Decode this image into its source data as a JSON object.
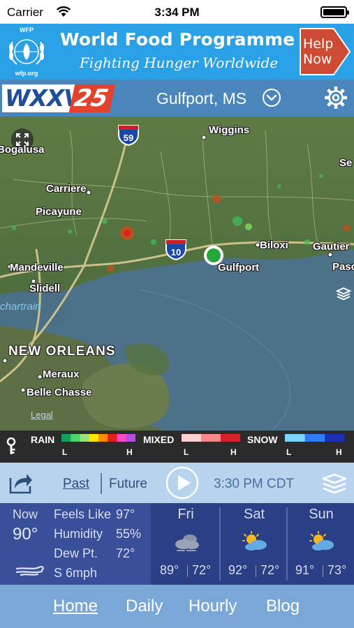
{
  "status_bar": {
    "carrier": "Carrier",
    "time": "3:34 PM"
  },
  "ad": {
    "logo_top": "WFP",
    "logo_bottom": "wfp.org",
    "title": "World Food Programme",
    "subtitle": "Fighting Hunger Worldwide",
    "cta": "Help Now"
  },
  "header": {
    "logo_letters": "WXXV",
    "logo_number": "25",
    "location": "Gulfport, MS"
  },
  "map": {
    "labels": {
      "bogalusa": "Bogalusa",
      "wiggins": "Wiggins",
      "carriere": "Carriere",
      "picayune": "Picayune",
      "biloxi": "Biloxi",
      "gautier": "Gautier",
      "mandeville": "Mandeville",
      "gulfport": "Gulfport",
      "pasc": "Pasc",
      "slidell": "Slidell",
      "lake": "tchartrain",
      "se": "Se",
      "new_orleans": "New Orleans",
      "meraux": "Meraux",
      "belle_chasse": "Belle Chasse",
      "legal": "Legal"
    },
    "shields": {
      "i59": "59",
      "i10": "10"
    }
  },
  "legend": {
    "rain": "RAIN",
    "mixed": "MIXED",
    "snow": "SNOW",
    "low": "L",
    "high": "H",
    "colors": {
      "rain": [
        "#12a05a",
        "#4fd26a",
        "#9be07c",
        "#ffe600",
        "#ff8c00",
        "#e0201a",
        "#ff49c8",
        "#b34fe0"
      ],
      "mixed": [
        "#ffd0d0",
        "#f28a8a",
        "#d8202a"
      ],
      "snow": [
        "#7fd3ff",
        "#2d7cf5",
        "#1a2fb4"
      ]
    }
  },
  "controls": {
    "past": "Past",
    "future": "Future",
    "time": "3:30 PM CDT"
  },
  "current": {
    "now_label": "Now",
    "temp": "90°",
    "feels_like_label": "Feels Like",
    "feels_like": "97°",
    "humidity_label": "Humidity",
    "humidity": "55%",
    "dewpt_label": "Dew Pt.",
    "dewpt": "72°",
    "wind": "S 6mph"
  },
  "forecast": [
    {
      "day": "Fri",
      "hi": "89°",
      "lo": "72°",
      "icon": "cloudy-icon"
    },
    {
      "day": "Sat",
      "hi": "92°",
      "lo": "72°",
      "icon": "partly-sunny-icon"
    },
    {
      "day": "Sun",
      "hi": "91°",
      "lo": "73°",
      "icon": "partly-sunny-icon"
    }
  ],
  "nav": [
    "Home",
    "Daily",
    "Hourly",
    "Blog"
  ]
}
